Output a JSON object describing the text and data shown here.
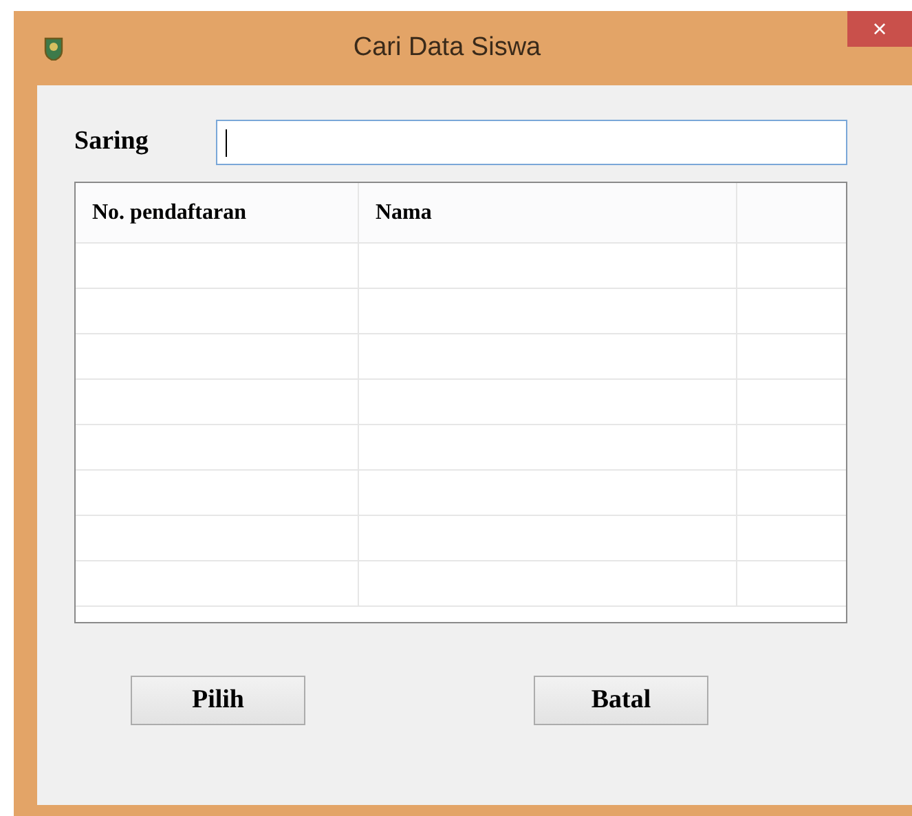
{
  "window": {
    "title": "Cari Data Siswa",
    "close": "×"
  },
  "filter": {
    "label": "Saring",
    "focused": true
  },
  "table": {
    "columns": [
      "No. pendaftaran",
      "Nama"
    ]
  },
  "buttons": [
    "Pilih",
    "Batal"
  ]
}
